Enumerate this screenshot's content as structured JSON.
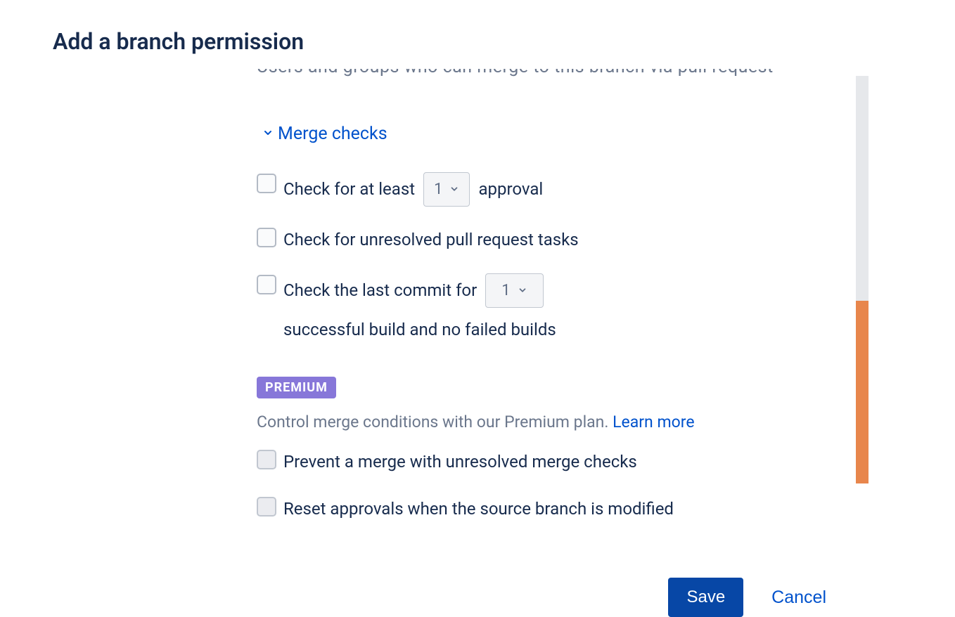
{
  "dialog": {
    "title": "Add a branch permission"
  },
  "truncated_header": "Users and groups who can merge to this branch via pull request",
  "merge_checks": {
    "section_label": "Merge checks",
    "approval": {
      "label_before": "Check for at least",
      "count": "1",
      "label_after": "approval"
    },
    "tasks": {
      "label": "Check for unresolved pull request tasks"
    },
    "builds": {
      "label_before": "Check the last commit for",
      "count": "1",
      "label_after": "successful build and no failed builds"
    }
  },
  "premium": {
    "badge": "PREMIUM",
    "description": "Control merge conditions with our Premium plan. ",
    "learn_more": "Learn more",
    "prevent": "Prevent a merge with unresolved merge checks",
    "reset": "Reset approvals when the source branch is modified"
  },
  "buttons": {
    "save": "Save",
    "cancel": "Cancel"
  }
}
